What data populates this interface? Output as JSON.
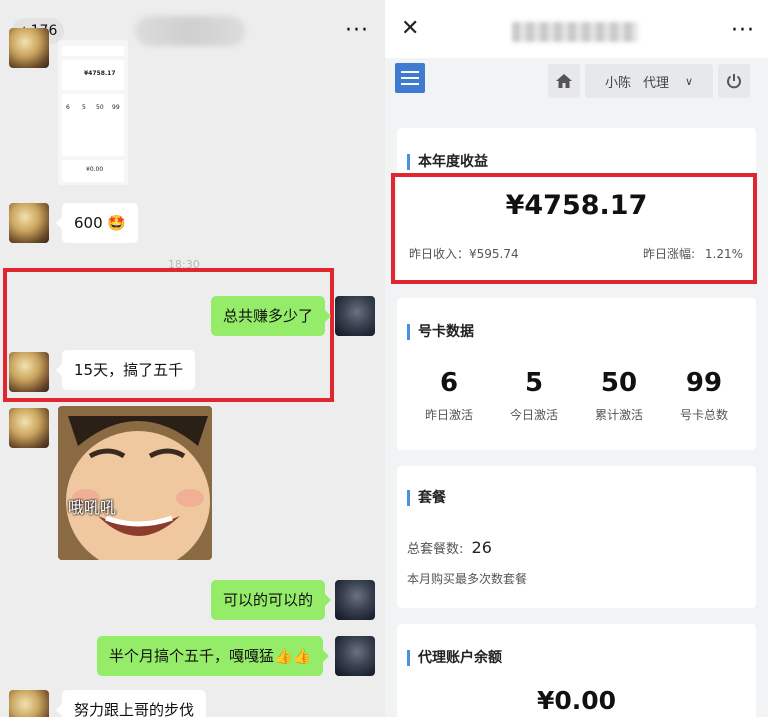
{
  "chat": {
    "back_count": "176",
    "more_icon": "···",
    "timestamp": "18:30",
    "messages": [
      {
        "from": "other",
        "text": "600"
      },
      {
        "from": "me",
        "text": "总共赚多少了"
      },
      {
        "from": "other",
        "text": "15天，搞了五千"
      },
      {
        "from": "other",
        "sticker_text": "哦吼吼"
      },
      {
        "from": "me",
        "text": "可以的可以的"
      },
      {
        "from": "me",
        "text": "半个月搞个五千，嘎嘎猛👍👍"
      },
      {
        "from": "other",
        "text": "努力跟上哥的步伐"
      }
    ],
    "thumbnail": {
      "amount": "¥4758.17",
      "stats": [
        "6",
        "5",
        "50",
        "99"
      ],
      "balance": "¥0.00"
    }
  },
  "app": {
    "close_icon": "✕",
    "more_icon": "···",
    "user_name": "小陈",
    "user_role": "代理",
    "annual": {
      "title": "本年度收益",
      "amount": "¥4758.17",
      "yesterday_income_label": "昨日收入：",
      "yesterday_income": "¥595.74",
      "yesterday_growth_label": "昨日涨幅:",
      "yesterday_growth": "1.21%"
    },
    "cards": {
      "title": "号卡数据",
      "stats": [
        {
          "value": "6",
          "label": "昨日激活"
        },
        {
          "value": "5",
          "label": "今日激活"
        },
        {
          "value": "50",
          "label": "累计激活"
        },
        {
          "value": "99",
          "label": "号卡总数"
        }
      ]
    },
    "package": {
      "title": "套餐",
      "total_label": "总套餐数:",
      "total": "26",
      "note": "本月购买最多次数套餐"
    },
    "balance": {
      "title": "代理账户余额",
      "amount": "¥0.00"
    }
  },
  "colors": {
    "highlight_red": "#e0262e",
    "wechat_green": "#95ec69",
    "accent_blue": "#3f7bd1"
  }
}
